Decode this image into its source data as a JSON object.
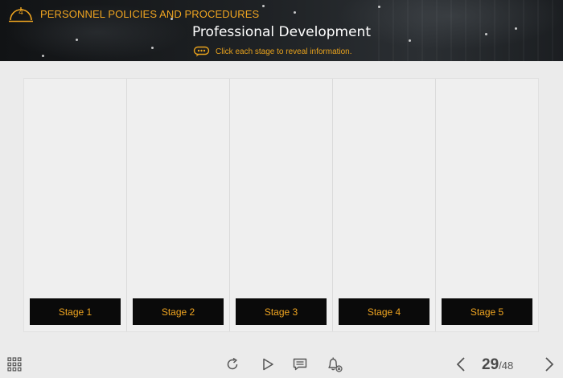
{
  "header": {
    "chapter_number": "4",
    "chapter_title": "PERSONNEL POLICIES AND PROCEDURES",
    "page_title": "Professional Development",
    "instruction": "Click each stage to reveal information."
  },
  "stages": [
    {
      "label": "Stage 1"
    },
    {
      "label": "Stage 2"
    },
    {
      "label": "Stage 3"
    },
    {
      "label": "Stage 4"
    },
    {
      "label": "Stage 5"
    }
  ],
  "toolbar": {
    "icons": {
      "menu": "grid-menu-icon",
      "replay": "replay-icon",
      "play": "play-icon",
      "notes": "notes-icon",
      "mute": "bell-mute-icon",
      "prev": "chevron-left-icon",
      "next": "chevron-right-icon"
    },
    "page_current": "29",
    "page_separator": "/",
    "page_total": "48"
  },
  "colors": {
    "accent": "#f0a520",
    "header_bg": "#16181a",
    "stage_button_bg": "#0a0a0a",
    "content_bg": "#efefef",
    "toolbar_icon": "#555555"
  }
}
